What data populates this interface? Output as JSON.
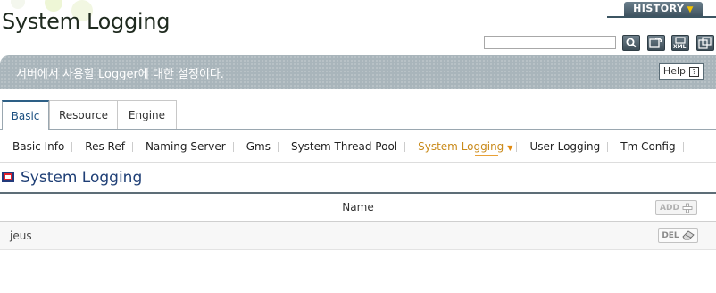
{
  "page": {
    "title": "System Logging"
  },
  "header": {
    "history_label": "HISTORY",
    "search": {
      "value": "",
      "placeholder": ""
    },
    "icons": [
      "search-icon",
      "refresh-icon",
      "xml-icon",
      "export-icon"
    ]
  },
  "banner": {
    "text": "서버에서 사용할 Logger에 대한 설정이다.",
    "help_label": "Help",
    "help_icon": "?"
  },
  "tabs": [
    {
      "label": "Basic",
      "active": true
    },
    {
      "label": "Resource",
      "active": false
    },
    {
      "label": "Engine",
      "active": false
    }
  ],
  "subnav": [
    {
      "label": "Basic Info"
    },
    {
      "label": "Res Ref"
    },
    {
      "label": "Naming Server"
    },
    {
      "label": "Gms"
    },
    {
      "label": "System Thread Pool"
    },
    {
      "label": "System Logging",
      "active": true
    },
    {
      "label": "User Logging"
    },
    {
      "label": "Tm Config"
    }
  ],
  "section": {
    "title": "System Logging"
  },
  "table": {
    "column_header": "Name",
    "add_label": "ADD",
    "rows": [
      {
        "name": "jeus",
        "del_label": "DEL"
      }
    ]
  },
  "colors": {
    "accent": "#1f3f76",
    "active_subnav": "#c98a1a",
    "banner": "#a9b5bb"
  }
}
